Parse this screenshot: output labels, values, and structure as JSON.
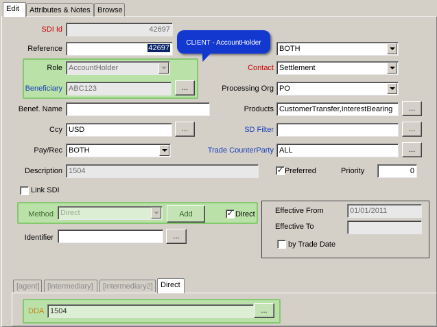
{
  "tabs": [
    "Edit",
    "Attributes & Notes",
    "Browse"
  ],
  "tooltip": "CLIENT - AccountHolder",
  "left": {
    "sdi_id_label": "SDI Id",
    "sdi_id_value": "42697",
    "reference_label": "Reference",
    "reference_value": "42697",
    "role_label": "Role",
    "role_value": "AccountHolder",
    "beneficiary_label": "Beneficiary",
    "beneficiary_value": "ABC123",
    "benef_name_label": "Benef. Name",
    "benef_name_value": "",
    "ccy_label": "Ccy",
    "ccy_value": "USD",
    "payrec_label": "Pay/Rec",
    "payrec_value": "BOTH",
    "description_label": "Description",
    "description_value": "1504",
    "link_sdi_label": "Link SDI",
    "method_label": "Method",
    "method_value": "Direct",
    "add_label": "Add",
    "direct_check_label": "Direct",
    "identifier_label": "Identifier",
    "identifier_value": ""
  },
  "right": {
    "top_combo_value": "BOTH",
    "contact_label": "Contact",
    "contact_value": "Settlement",
    "processing_org_label": "Processing Org",
    "processing_org_value": "PO",
    "products_label": "Products",
    "products_value": "CustomerTransfer,InterestBearing",
    "sd_filter_label": "SD Filter",
    "sd_filter_value": "",
    "trade_cp_label": "Trade CounterParty",
    "trade_cp_value": "ALL",
    "preferred_label": "Preferred",
    "priority_label": "Priority",
    "priority_value": "0",
    "effective_from_label": "Effective From",
    "effective_from_value": "01/01/2011",
    "effective_to_label": "Effective To",
    "effective_to_value": "",
    "by_trade_date_label": "by Trade Date"
  },
  "ellipsis": "...",
  "bottom_tabs": [
    "[agent]",
    "[intermediary]",
    "[intermediary2]",
    "Direct"
  ],
  "dda_label": "DDA",
  "dda_value": "1504",
  "colors": {
    "tooltip": "#1238d0",
    "green_box": "#b9e1a8",
    "red_label": "#cc0000",
    "blue_label": "#1a3fb8"
  }
}
